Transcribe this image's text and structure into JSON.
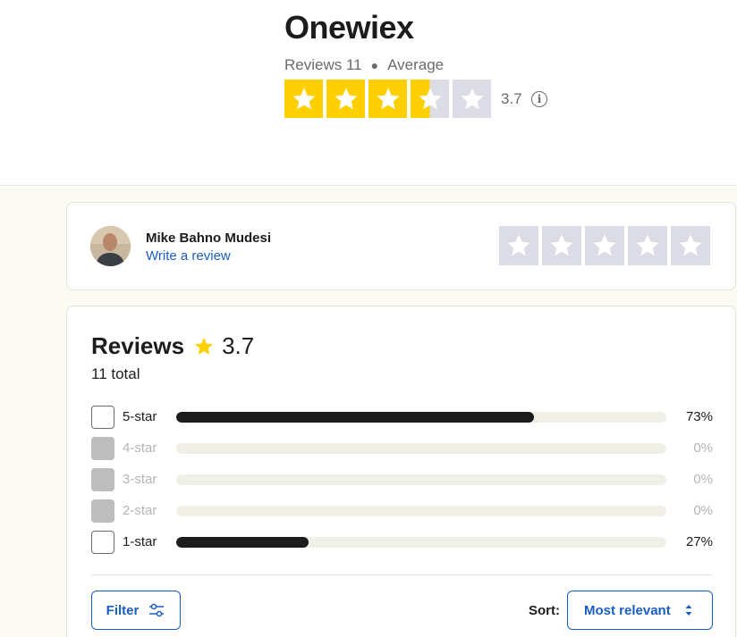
{
  "company": {
    "name": "Onewiex",
    "reviews_label": "Reviews 11",
    "rating_word": "Average",
    "rating_value": "3.7",
    "stars_filled": 3.5,
    "info_icon": "info-icon"
  },
  "colors": {
    "star_filled": "#ffcf00",
    "star_empty": "#dcdce6",
    "link": "#1b5ec2",
    "bar": "#1c1c1c",
    "bar_track": "#f1f0e6"
  },
  "writer": {
    "user_name": "Mike Bahno Mudesi",
    "write_link": "Write a review",
    "empty_stars": 5
  },
  "reviews": {
    "title": "Reviews",
    "rating": "3.7",
    "total": "11 total",
    "distribution": [
      {
        "label": "5-star",
        "percent_text": "73%",
        "percent": 73,
        "enabled": true
      },
      {
        "label": "4-star",
        "percent_text": "0%",
        "percent": 0,
        "enabled": false
      },
      {
        "label": "3-star",
        "percent_text": "0%",
        "percent": 0,
        "enabled": false
      },
      {
        "label": "2-star",
        "percent_text": "0%",
        "percent": 0,
        "enabled": false
      },
      {
        "label": "1-star",
        "percent_text": "27%",
        "percent": 27,
        "enabled": true
      }
    ]
  },
  "controls": {
    "filter_label": "Filter",
    "filter_icon": "sliders-icon",
    "sort_label": "Sort:",
    "sort_value": "Most relevant",
    "sort_icon": "sort-arrows-icon"
  }
}
